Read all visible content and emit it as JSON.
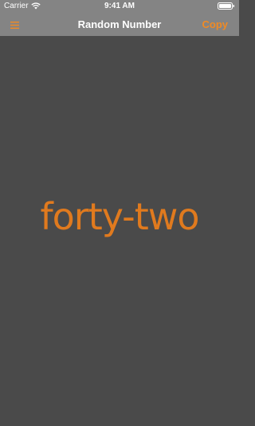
{
  "status_bar": {
    "carrier": "Carrier",
    "time": "9:41 AM",
    "wifi_icon": "wifi-icon",
    "battery_icon": "battery-icon"
  },
  "nav_bar": {
    "menu_icon": "hamburger-menu-icon",
    "title": "Random Number",
    "copy_label": "Copy"
  },
  "main": {
    "number_text": "forty-two"
  },
  "colors": {
    "nav_background": "#848484",
    "screen_background": "#4a4a4a",
    "accent": "#e07a1e",
    "title_text": "#ffffff"
  }
}
